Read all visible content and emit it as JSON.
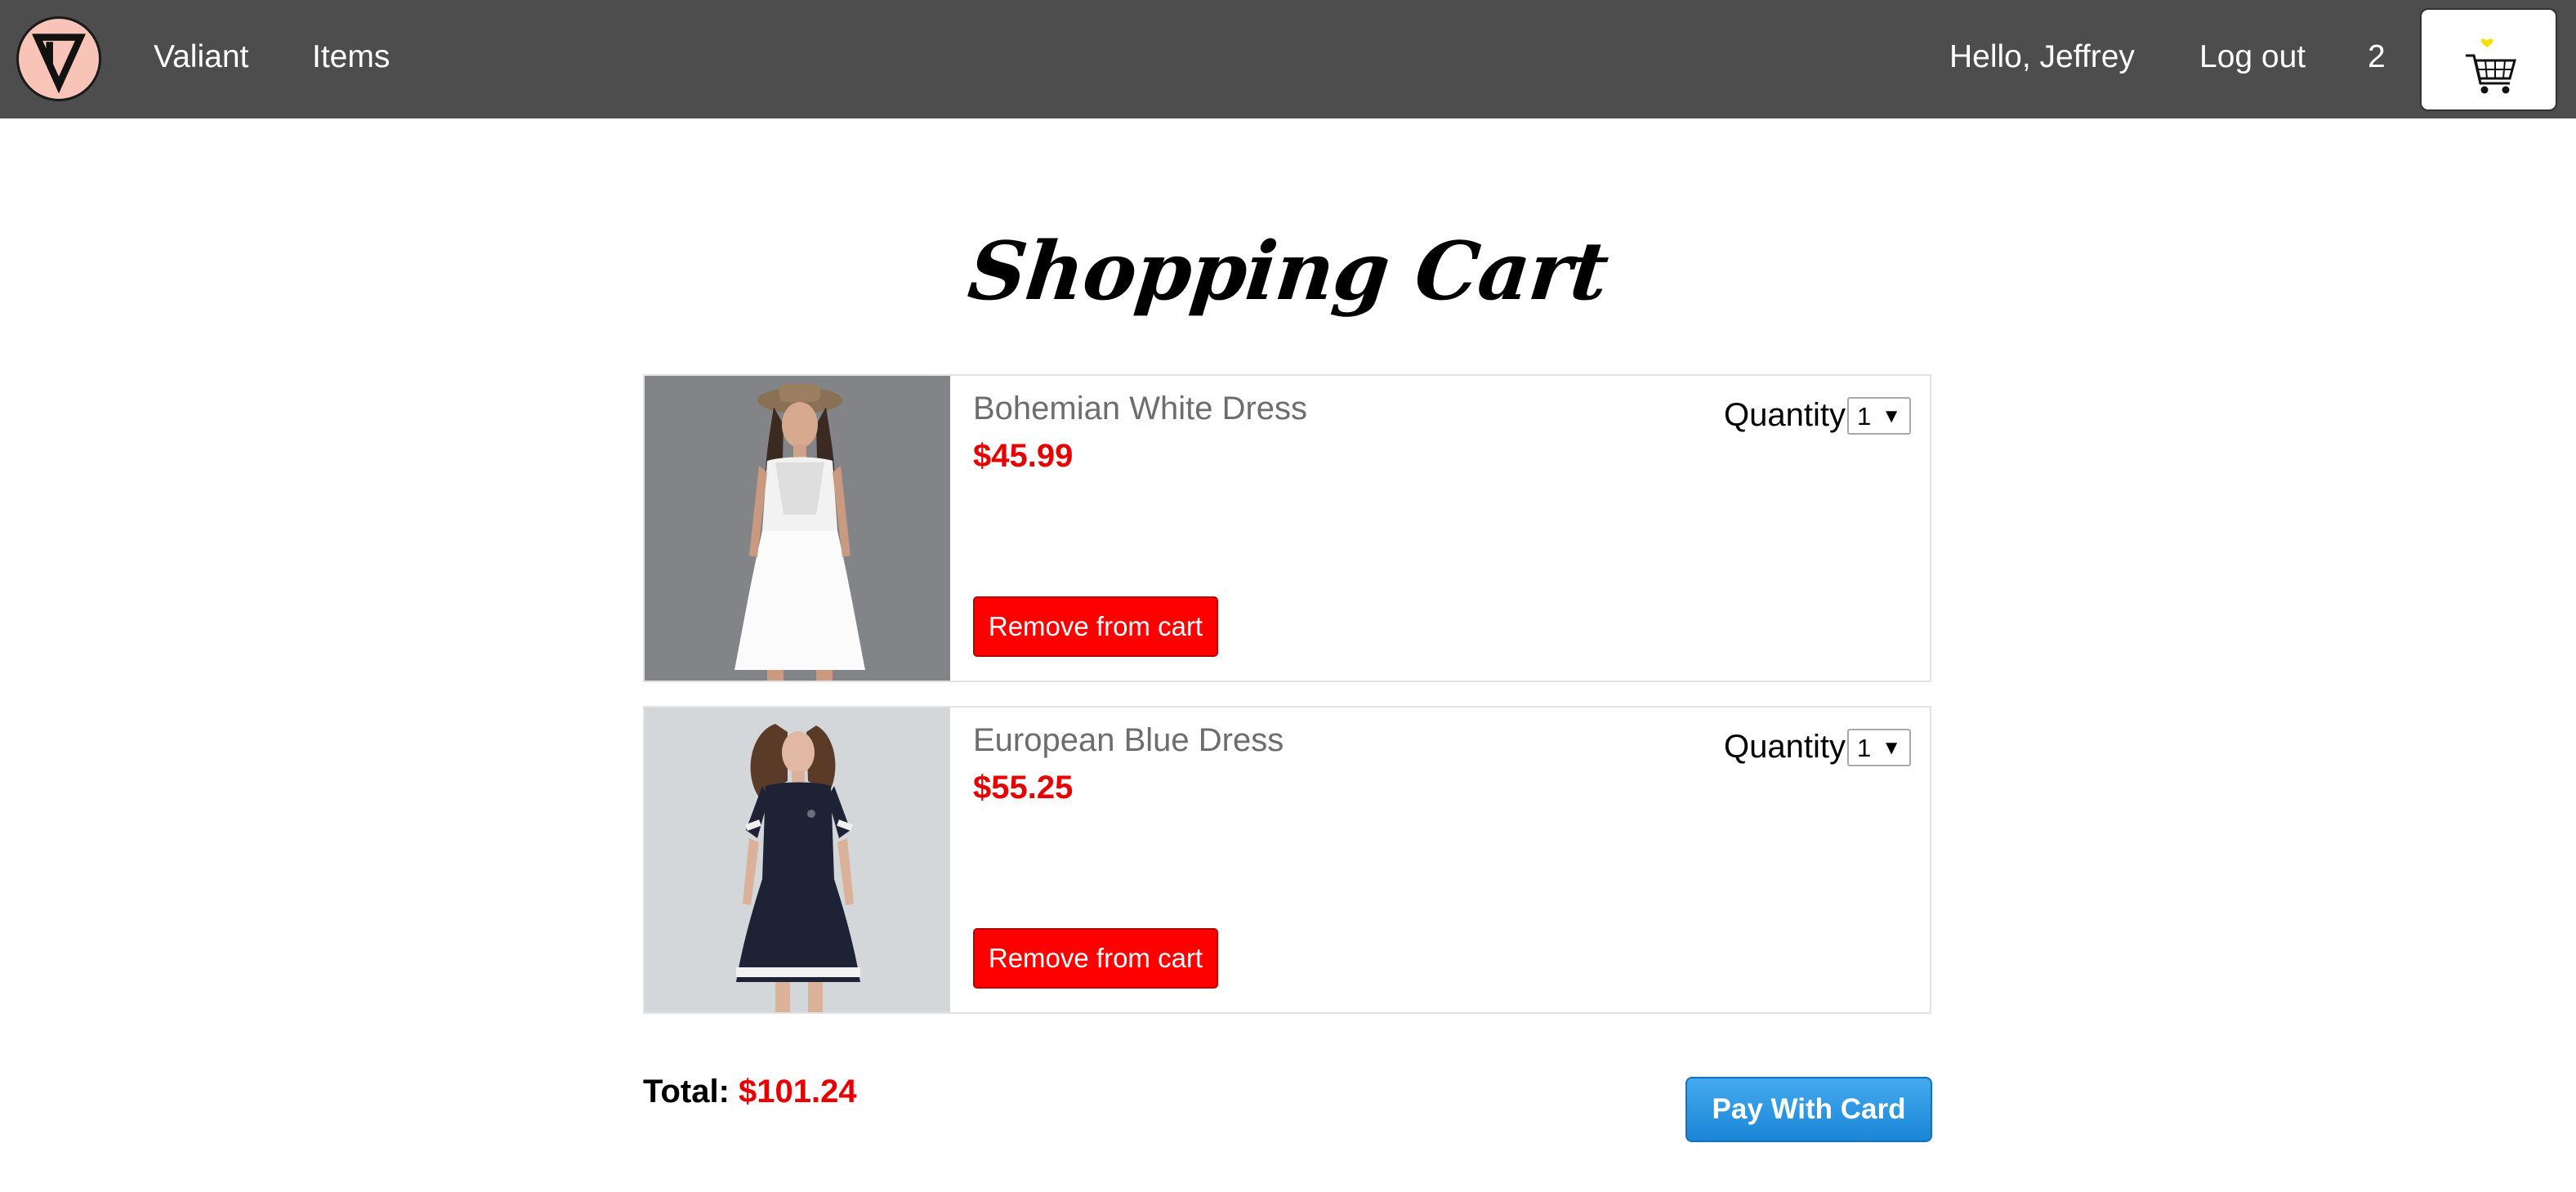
{
  "nav": {
    "brand": "Valiant",
    "items_link": "Items",
    "greeting": "Hello, Jeffrey",
    "logout": "Log out",
    "cart_count": "2"
  },
  "page": {
    "title": "Shopping Cart"
  },
  "cart_items": [
    {
      "name": "Bohemian White Dress",
      "price": "$45.99",
      "quantity_label": "Quantity",
      "quantity": "1",
      "remove_label": "Remove from cart"
    },
    {
      "name": "European Blue Dress",
      "price": "$55.25",
      "quantity_label": "Quantity",
      "quantity": "1",
      "remove_label": "Remove from cart"
    }
  ],
  "summary": {
    "total_label": "Total:",
    "total_amount": "$101.24",
    "pay_label": "Pay With Card"
  },
  "colors": {
    "navbar": "#4d4d4d",
    "price_red": "#e60000",
    "remove_red": "#ff0000",
    "pay_blue": "#2a96e0"
  },
  "icons": [
    "logo-icon",
    "cart-icon",
    "dropdown-arrow-icon"
  ]
}
